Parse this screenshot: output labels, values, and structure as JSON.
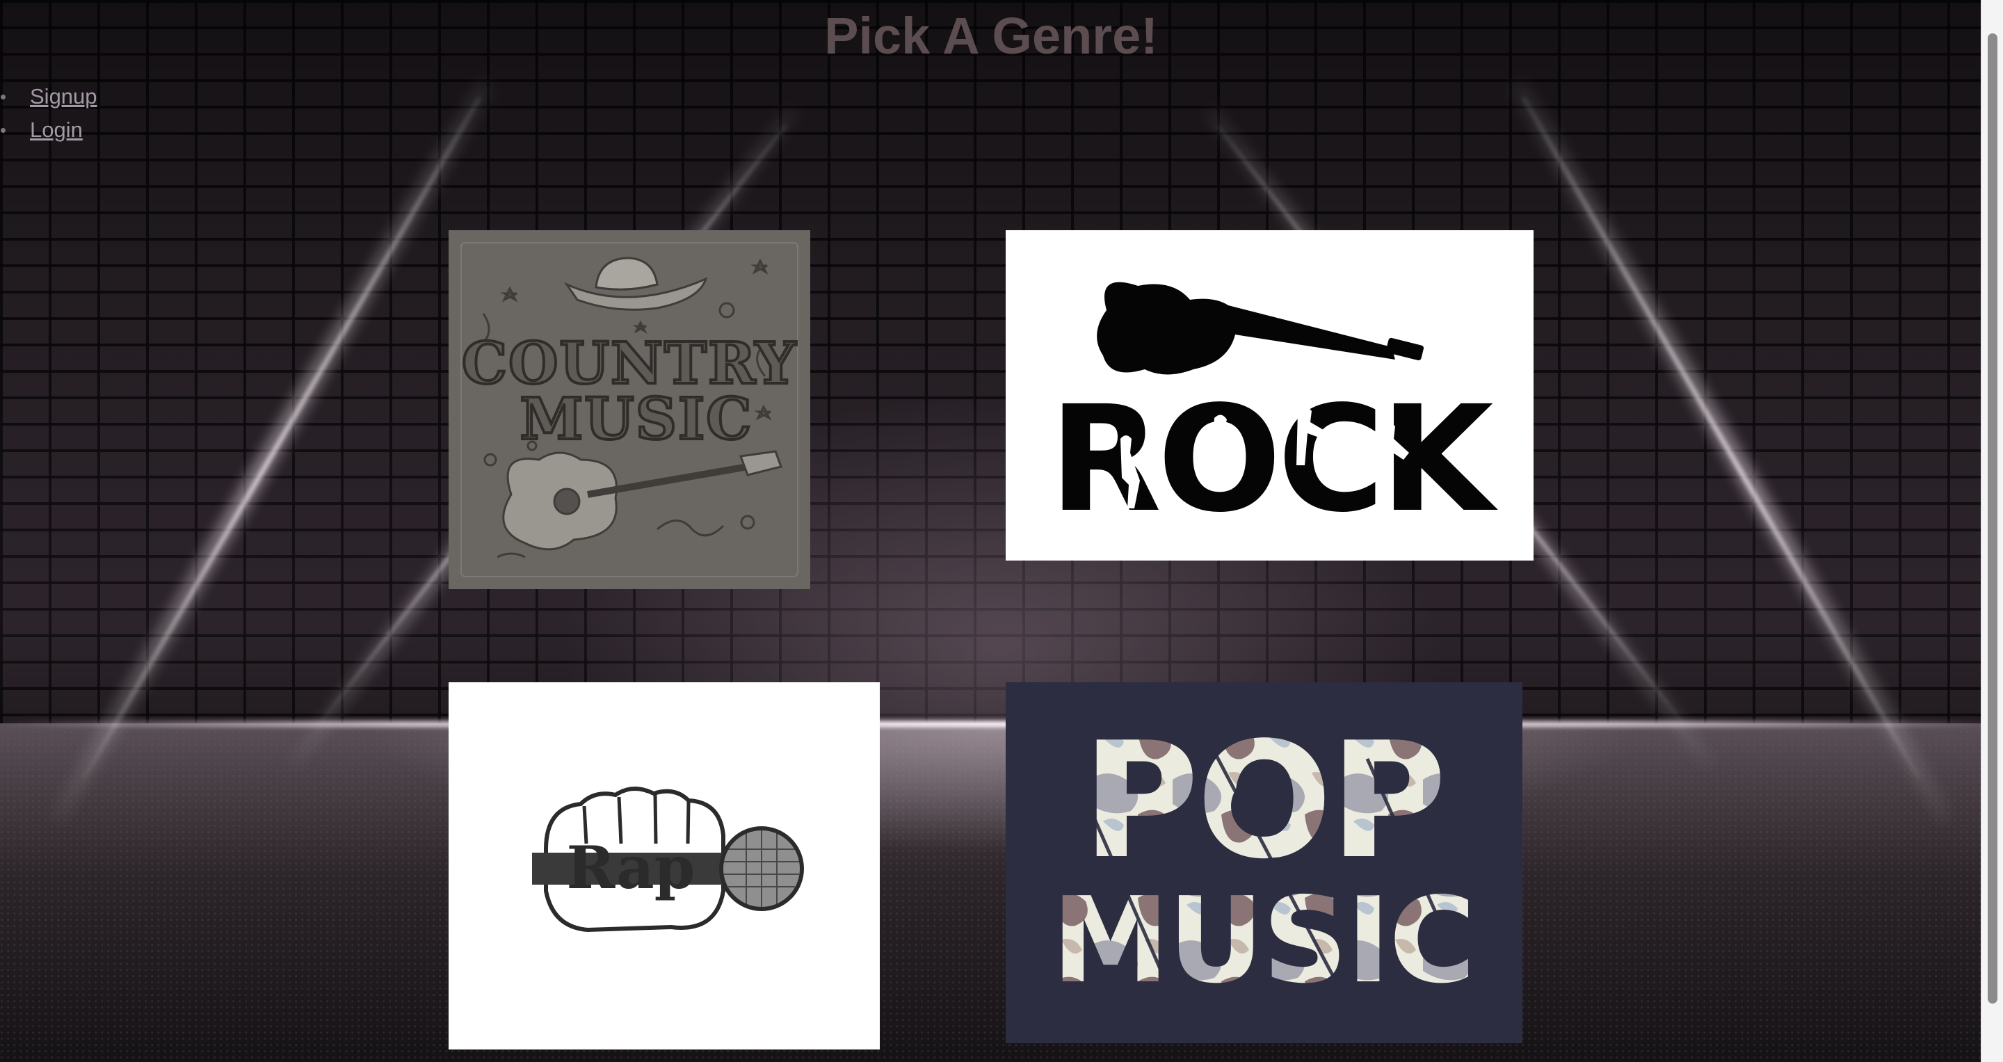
{
  "page": {
    "title": "Pick A Genre!"
  },
  "nav": {
    "items": [
      {
        "label": "Signup"
      },
      {
        "label": "Login"
      }
    ]
  },
  "genres": [
    {
      "id": "country",
      "image_text": "COUNTRY MUSIC",
      "icon": "guitar-and-cowboy-hat-icon"
    },
    {
      "id": "rock",
      "image_text": "ROCK",
      "icon": "electric-guitar-icon"
    },
    {
      "id": "rap",
      "image_text": "Rap",
      "icon": "fist-with-microphone-icon"
    },
    {
      "id": "pop",
      "image_text": "POP MUSIC",
      "icon": "vinyl-record-icon"
    }
  ],
  "colors": {
    "title": "#5b4d50",
    "link": "#a29aa6",
    "country_bg": "#6a6661",
    "pop_bg": "#2c2d40"
  }
}
